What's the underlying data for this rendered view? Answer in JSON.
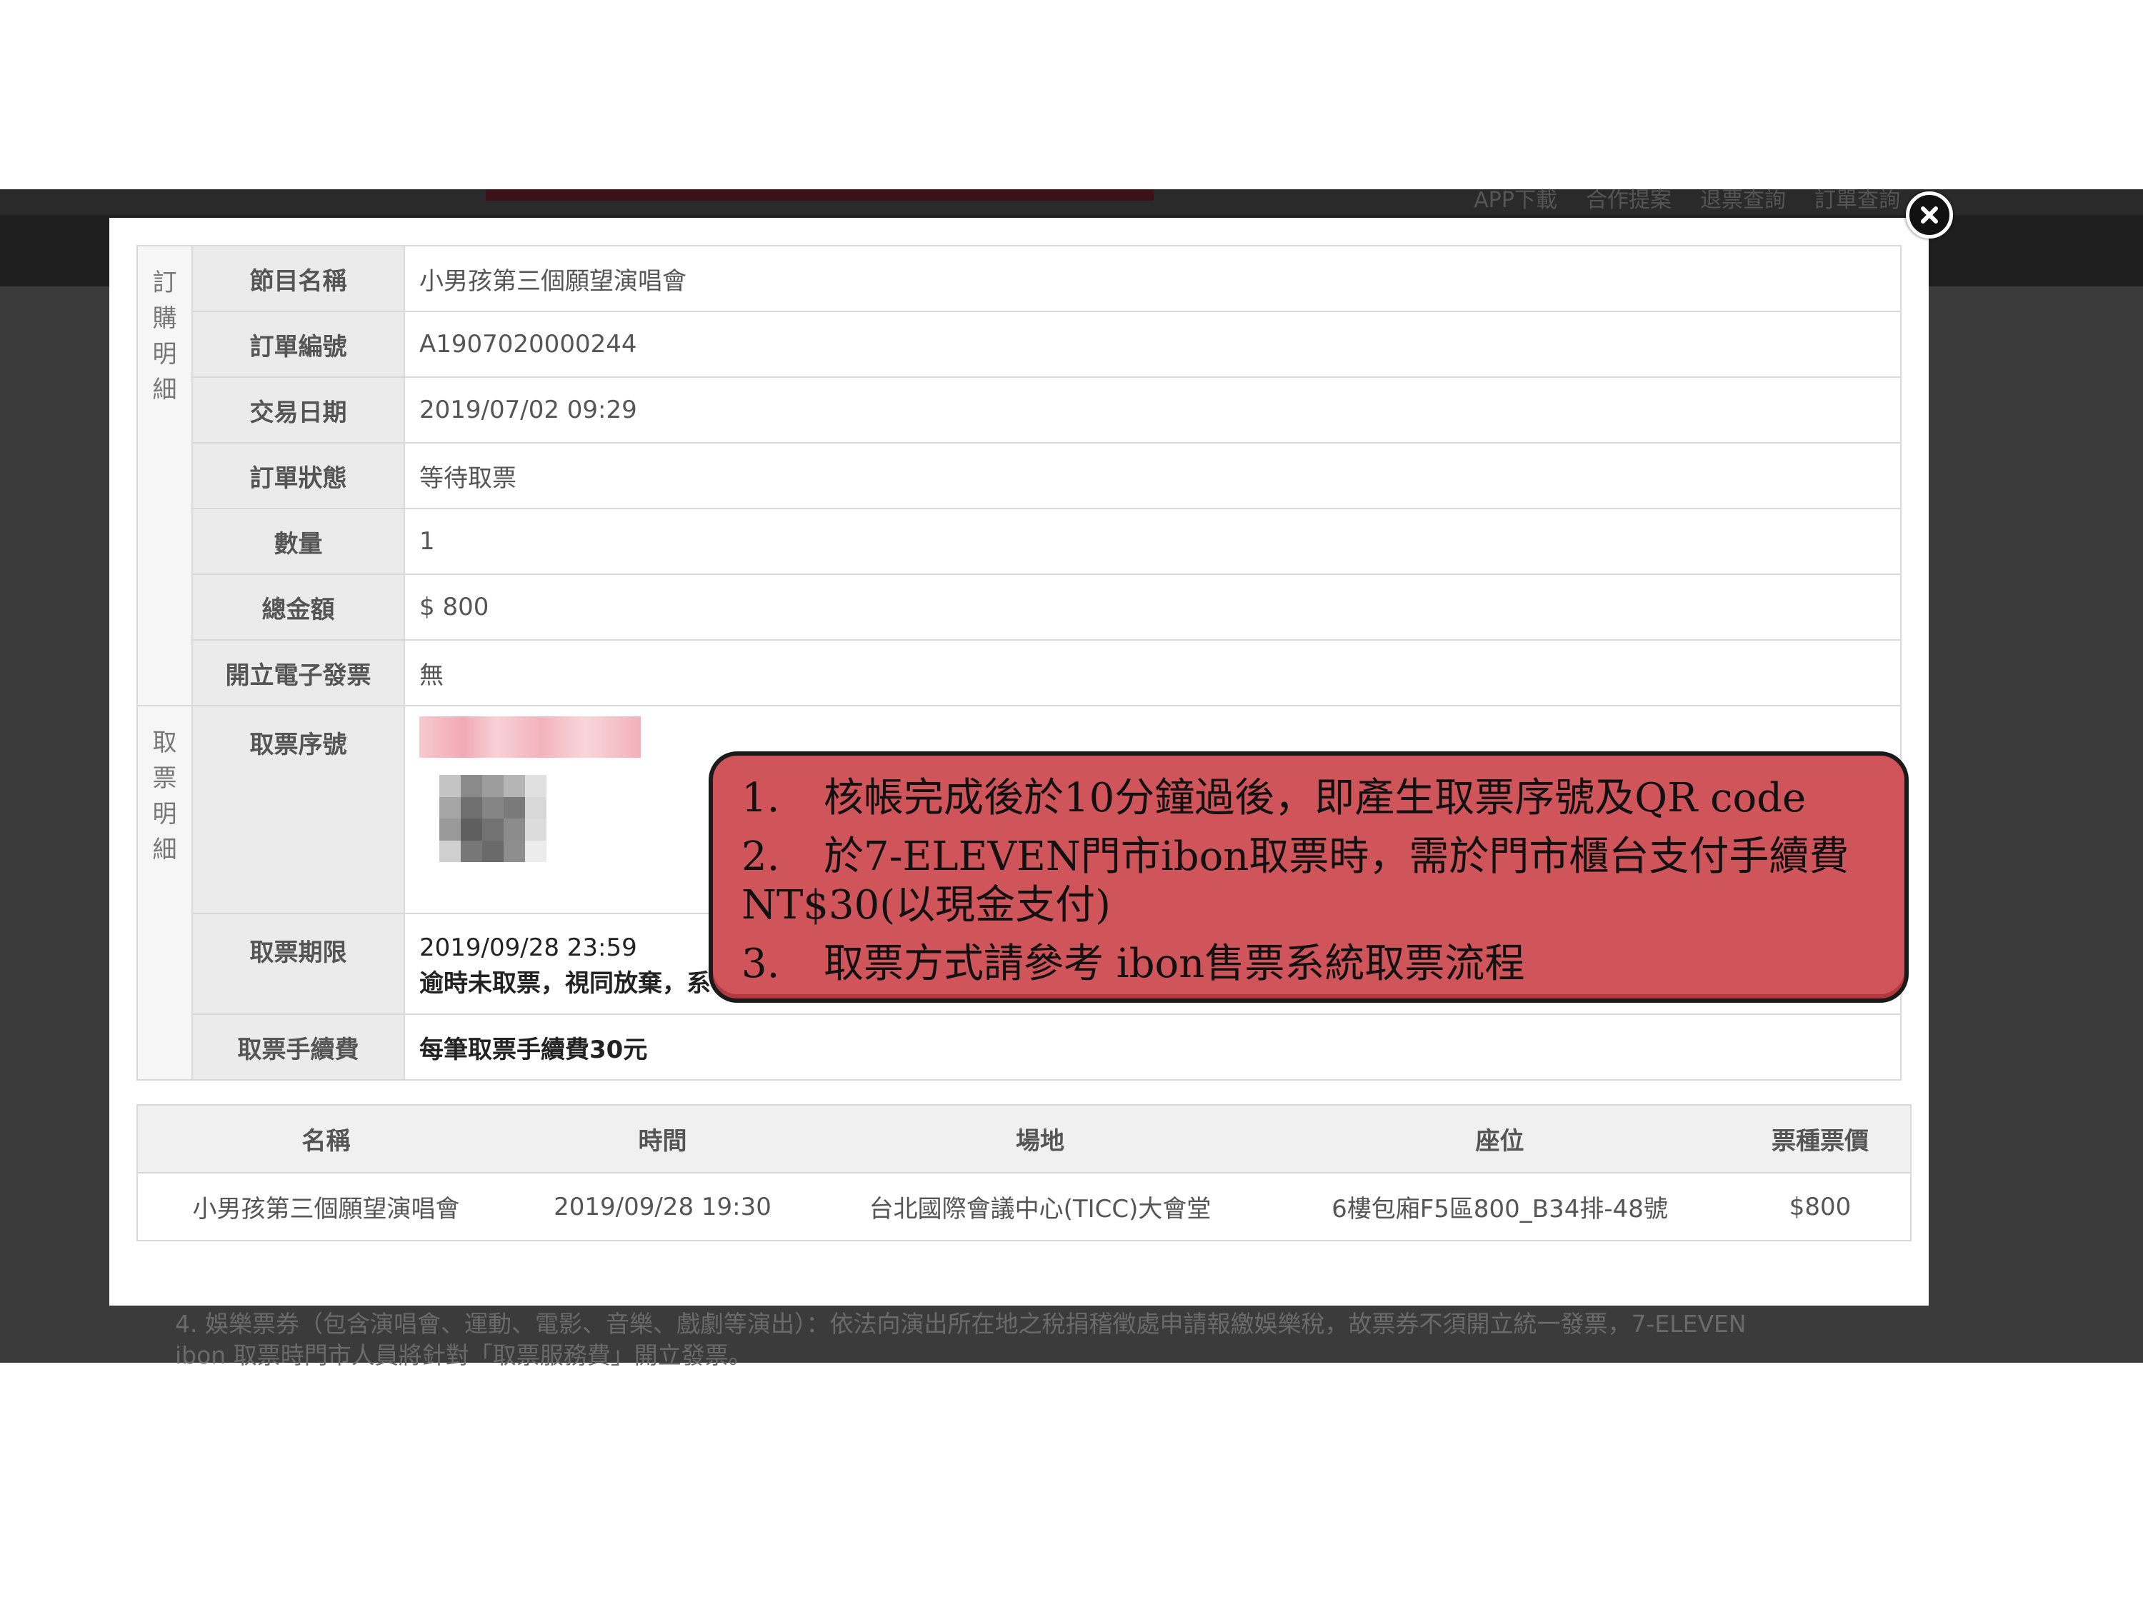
{
  "background": {
    "nav_links": [
      "APP下載",
      "合作提案",
      "退票查詢",
      "訂單查詢"
    ],
    "footer_note": [
      "4. 娛樂票券（包含演唱會、運動、電影、音樂、戲劇等演出）：依法向演出所在地之稅捐稽徵處申請報繳娛樂稅，故票券不須開立統一發票，7-ELEVEN",
      "ibon 取票時門市人員將針對「取票服務費」開立發票。"
    ]
  },
  "modal": {
    "close_icon": "close-icon",
    "sections": {
      "order": [
        "訂",
        "購",
        "明",
        "細"
      ],
      "pickup": [
        "取",
        "票",
        "明",
        "細"
      ]
    },
    "order_rows": [
      {
        "label": "節目名稱",
        "value": "小男孩第三個願望演唱會"
      },
      {
        "label": "訂單編號",
        "value": "A1907020000244"
      },
      {
        "label": "交易日期",
        "value": "2019/07/02 09:29"
      },
      {
        "label": "訂單狀態",
        "value": "等待取票"
      },
      {
        "label": "數量",
        "value": "1"
      },
      {
        "label": "總金額",
        "value": "$ 800"
      },
      {
        "label": "開立電子發票",
        "value": "無"
      }
    ],
    "pickup_rows": {
      "serial_label": "取票序號",
      "deadline_label": "取票期限",
      "deadline_value": "2019/09/28 23:59",
      "deadline_note": "逾時未取票，視同放棄，系",
      "fee_label": "取票手續費",
      "fee_value": "每筆取票手續費30元"
    },
    "event_table": {
      "headers": [
        "名稱",
        "時間",
        "場地",
        "座位",
        "票種票價"
      ],
      "rows": [
        [
          "小男孩第三個願望演唱會",
          "2019/09/28 19:30",
          "台北國際會議中心(TICC)大會堂",
          "6樓包廂F5區800_B34排-48號",
          "$800"
        ]
      ]
    }
  },
  "callout": {
    "items": [
      {
        "num": "1.",
        "text": "核帳完成後於10分鐘過後，即產生取票序號及QR code"
      },
      {
        "num": "2.",
        "text": "於7-ELEVEN門市ibon取票時，需於門市櫃台支付手續費",
        "continuation": "NT$30(以現金支付)"
      },
      {
        "num": "3.",
        "text": "取票方式請參考 ibon售票系統取票流程"
      }
    ],
    "color": "#d0555a"
  }
}
